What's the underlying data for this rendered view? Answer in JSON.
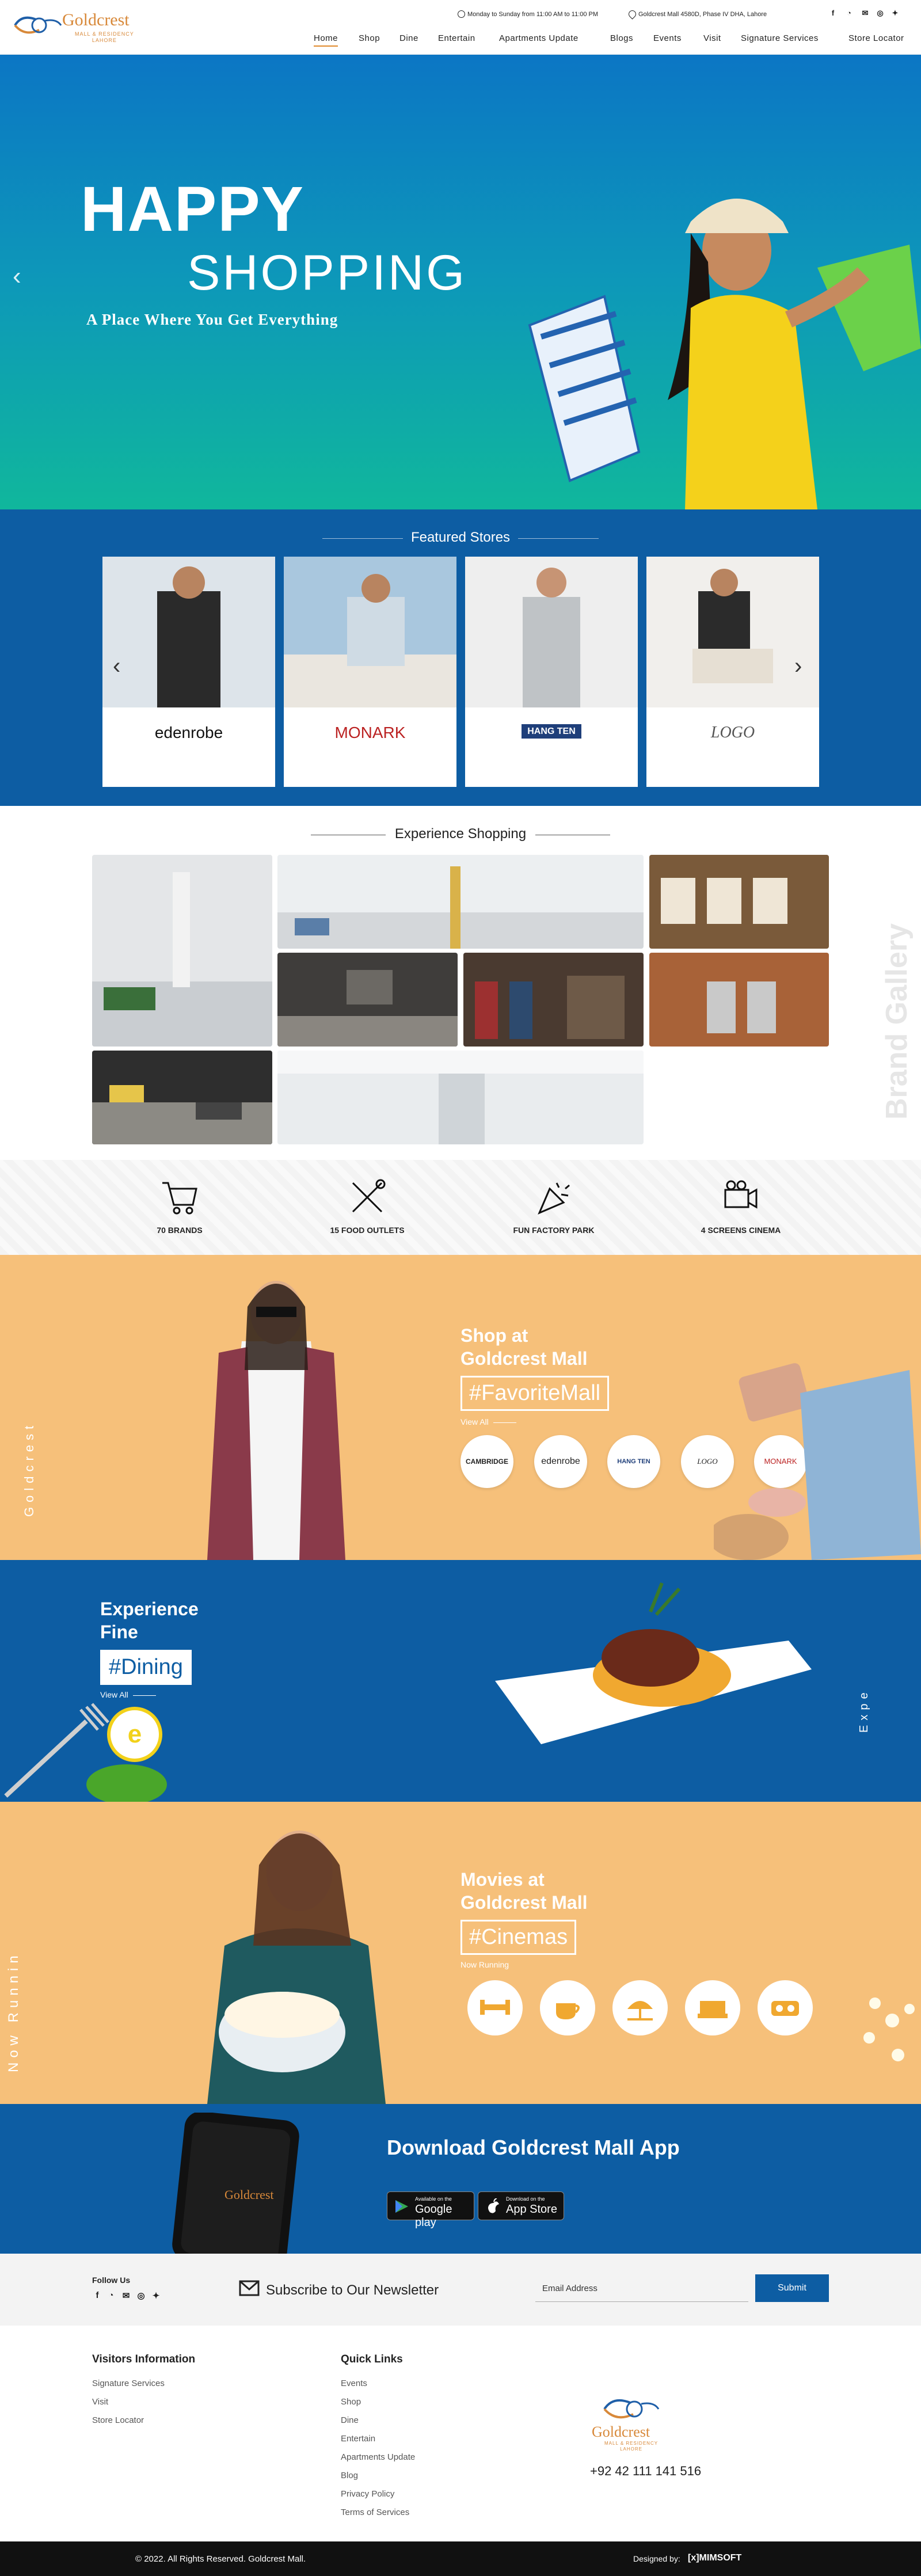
{
  "header": {
    "logo": {
      "name": "Goldcrest",
      "subline1": "MALL & RESIDENCY",
      "subline2": "LAHORE"
    },
    "hours": "Monday to Sunday from 11:00 AM to 11:00 PM",
    "address": "Goldcrest Mall 4580D, Phase IV DHA, Lahore",
    "social_icons": [
      "facebook-icon",
      "whatsapp-icon",
      "mail-icon",
      "instagram-icon",
      "twitter-icon"
    ],
    "nav": [
      "Home",
      "Shop",
      "Dine",
      "Entertain",
      "Apartments Update",
      "Blogs",
      "Events",
      "Visit",
      "Signature Services",
      "Store Locator"
    ],
    "active_nav": "Home"
  },
  "hero": {
    "line1": "HAPPY",
    "line2": "SHOPPING",
    "subtitle": "A Place Where You Get Everything",
    "prev_icon": "chevron-left-icon",
    "next_icon": "chevron-right-icon"
  },
  "featured": {
    "title": "Featured Stores",
    "stores": [
      {
        "brand": "edenrobe"
      },
      {
        "brand": "MONARK"
      },
      {
        "brand": "HANG TEN"
      },
      {
        "brand": "LOGO"
      }
    ]
  },
  "experience": {
    "title": "Experience Shopping",
    "side_label": "Brand Gallery"
  },
  "stats": [
    {
      "label": "70 BRANDS",
      "icon": "cart-icon"
    },
    {
      "label": "15 FOOD OUTLETS",
      "icon": "utensils-icon"
    },
    {
      "label": "FUN FACTORY PARK",
      "icon": "party-icon"
    },
    {
      "label": "4 SCREENS CINEMA",
      "icon": "movie-camera-icon"
    }
  ],
  "shop_promo": {
    "heading_line1": "Shop at",
    "heading_line2": "Goldcrest Mall",
    "tag": "#FavoriteMall",
    "view_all": "View All",
    "side_label": "Goldcrest",
    "brands": [
      "CAMBRIDGE",
      "edenrobe",
      "HANG TEN",
      "LOGO",
      "MONARK"
    ]
  },
  "dine_promo": {
    "heading_line1": "Experience",
    "heading_line2": "Fine",
    "tag": "#Dining",
    "view_all": "View All",
    "side_label": "Expe",
    "badge": "e"
  },
  "cinema_promo": {
    "heading_line1": "Movies at",
    "heading_line2": "Goldcrest Mall",
    "tag": "#Cinemas",
    "now_running": "Now Running",
    "side_label": "Now Runnin",
    "icons": [
      "dumbbell-icon",
      "coffee-icon",
      "beach-icon",
      "cinema-seats-icon",
      "vr-headset-icon"
    ]
  },
  "app": {
    "title": "Download Goldcrest Mall App",
    "google_small": "Available on the",
    "google_big": "Google play",
    "apple_small": "Download on the",
    "apple_big": "App Store"
  },
  "newsletter": {
    "follow_label": "Follow Us",
    "title": "Subscribe to Our Newsletter",
    "email_placeholder": "Email Address",
    "submit": "Submit"
  },
  "footer": {
    "visitors_title": "Visitors Information",
    "visitors_links": [
      "Signature Services",
      "Visit",
      "Store Locator"
    ],
    "quick_title": "Quick Links",
    "quick_links": [
      "Events",
      "Shop",
      "Dine",
      "Entertain",
      "Apartments Update",
      "Blog",
      "Privacy Policy",
      "Terms of Services"
    ],
    "phone": "+92 42 111 141 516",
    "copyright": "© 2022. All Rights Reserved. Goldcrest Mall.",
    "designed_by": "Designed by:",
    "designer": "[x]MIMSOFT"
  },
  "colors": {
    "primary_blue": "#0d5da3",
    "orange": "#f6c07a",
    "accent": "#d8893a"
  }
}
